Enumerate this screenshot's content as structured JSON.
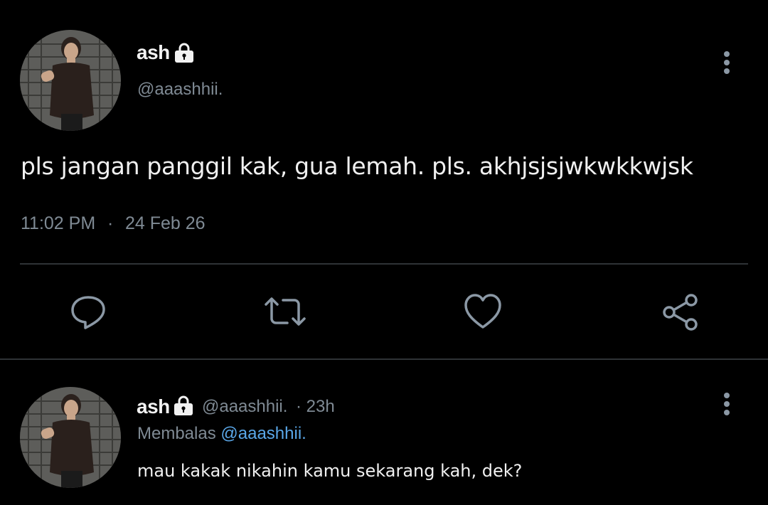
{
  "main_tweet": {
    "author_name": "ash",
    "author_handle": "@aaashhii.",
    "text": "pls jangan panggil kak, gua lemah. pls. akhjsjsjwkwkkwjsk",
    "time": "11:02 PM",
    "separator": "·",
    "date": "24 Feb 26",
    "icons": {
      "lock": "lock-icon",
      "more": "more-vertical-icon",
      "reply": "reply-icon",
      "retweet": "retweet-icon",
      "like": "heart-icon",
      "share": "share-icon"
    }
  },
  "reply_tweet": {
    "author_name": "ash",
    "author_handle": "@aaashhii.",
    "age": "· 23h",
    "replying_label": "Membalas",
    "replying_to": "@aaashhii.",
    "text": "mau kakak nikahin kamu sekarang kah, dek?"
  },
  "colors": {
    "background": "#000000",
    "text": "#f0f0f0",
    "secondary": "#7f8a94",
    "mention": "#5aa7e8",
    "divider": "#2f3336"
  }
}
